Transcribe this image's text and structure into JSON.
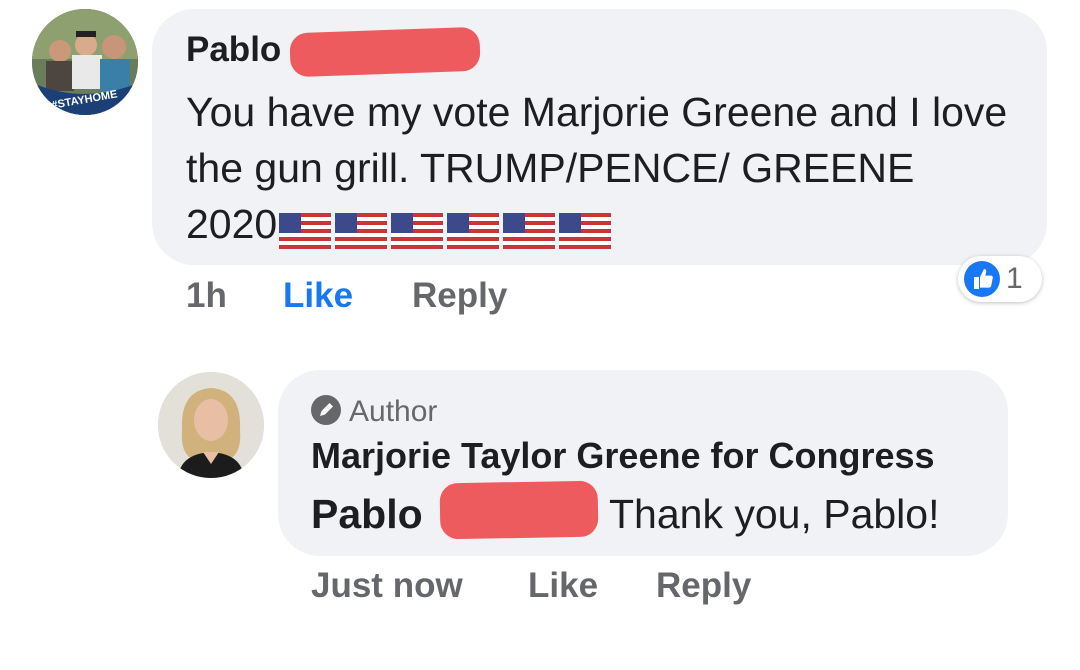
{
  "comment_1": {
    "author": "Pablo",
    "avatar_badge_text": "#STAYHOME",
    "text": "You have my vote Marjorie Greene and I love the gun grill. TRUMP/PENCE/ GREENE 2020",
    "flag_emoji_count": 6,
    "time": "1h",
    "like_label": "Like",
    "reply_label": "Reply",
    "reaction": {
      "icon": "thumbs-up-icon",
      "count": "1"
    }
  },
  "comment_2": {
    "author_badge": "Author",
    "author": "Marjorie Taylor Greene for Congress",
    "mention": "Pablo",
    "text": "Thank you, Pablo!",
    "time": "Just now",
    "like_label": "Like",
    "reply_label": "Reply"
  },
  "colors": {
    "bubble": "#f0f2f5",
    "text": "#1c1e21",
    "secondary": "#65676b",
    "like_active": "#1877f2",
    "redaction": "#ee5b5e"
  }
}
